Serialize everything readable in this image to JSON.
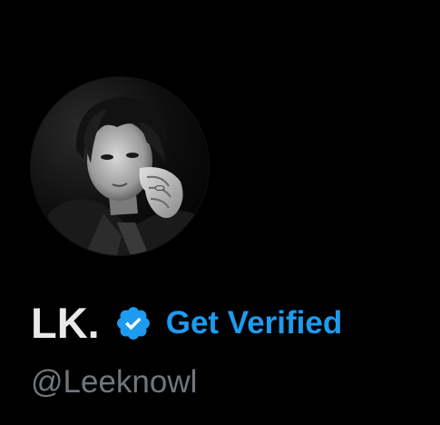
{
  "profile": {
    "display_name": "LK.",
    "verified_cta": "Get Verified",
    "handle": "@Leeknowl",
    "avatar_icon": "profile-photo",
    "badge_icon": "verified-badge-icon"
  },
  "colors": {
    "background": "#000000",
    "name": "#e7e9ea",
    "accent": "#1d9bf0",
    "handle": "#71767b"
  }
}
